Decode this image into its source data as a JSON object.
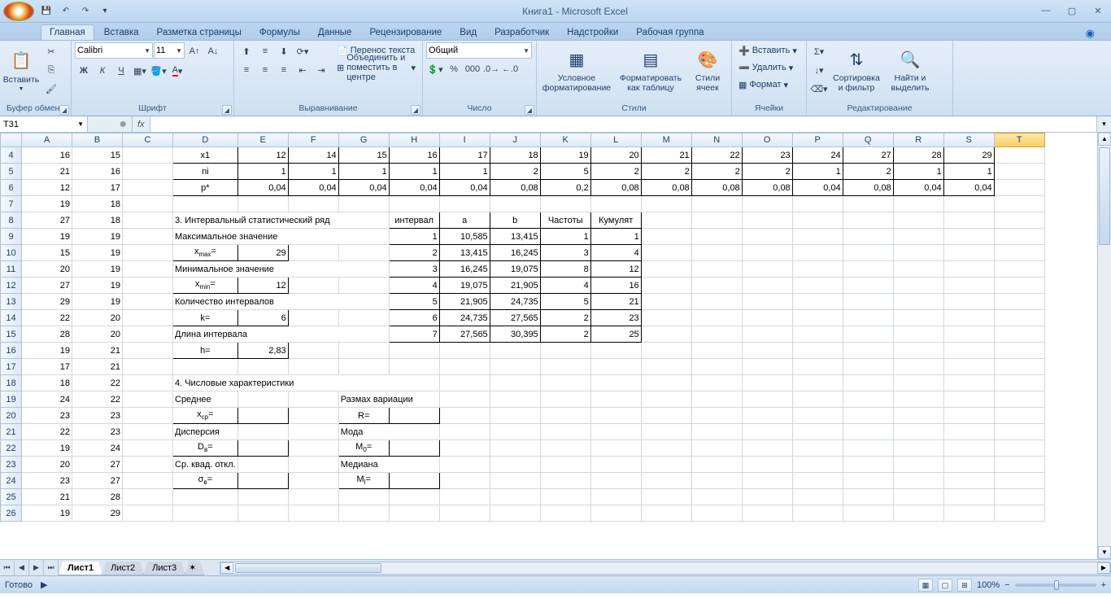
{
  "title": "Книга1 - Microsoft Excel",
  "tabs": [
    "Главная",
    "Вставка",
    "Разметка страницы",
    "Формулы",
    "Данные",
    "Рецензирование",
    "Вид",
    "Разработчик",
    "Надстройки",
    "Рабочая группа"
  ],
  "activeTab": 0,
  "ribbon": {
    "clipboard": {
      "paste": "Вставить",
      "title": "Буфер обмена"
    },
    "font": {
      "name": "Calibri",
      "size": "11",
      "title": "Шрифт",
      "bold": "Ж",
      "italic": "К",
      "underline": "Ч"
    },
    "align": {
      "title": "Выравнивание",
      "wrap": "Перенос текста",
      "merge": "Объединить и поместить в центре"
    },
    "number": {
      "title": "Число",
      "format": "Общий"
    },
    "styles": {
      "title": "Стили",
      "cond": "Условное форматирование",
      "ftable": "Форматировать как таблицу",
      "cstyles": "Стили ячеек"
    },
    "cells": {
      "title": "Ячейки",
      "insert": "Вставить",
      "delete": "Удалить",
      "format": "Формат"
    },
    "editing": {
      "title": "Редактирование",
      "sort": "Сортировка и фильтр",
      "find": "Найти и выделить"
    }
  },
  "nameBox": "T31",
  "formula": "",
  "columns": [
    "A",
    "B",
    "C",
    "D",
    "E",
    "F",
    "G",
    "H",
    "I",
    "J",
    "K",
    "L",
    "M",
    "N",
    "O",
    "P",
    "Q",
    "R",
    "S",
    "T"
  ],
  "rows": [
    4,
    5,
    6,
    7,
    8,
    9,
    10,
    11,
    12,
    13,
    14,
    15,
    16,
    17,
    18,
    19,
    20,
    21,
    22,
    23,
    24,
    25,
    26
  ],
  "activeCell": {
    "row": 31,
    "col": "T",
    "ref": "T31"
  },
  "cells": {
    "4": {
      "A": "16",
      "B": "15",
      "D": "x1",
      "E": "12",
      "F": "14",
      "G": "15",
      "H": "16",
      "I": "17",
      "J": "18",
      "K": "19",
      "L": "20",
      "M": "21",
      "N": "22",
      "O": "23",
      "P": "24",
      "Q": "27",
      "R": "28",
      "S": "29"
    },
    "5": {
      "A": "21",
      "B": "16",
      "D": "ni",
      "E": "1",
      "F": "1",
      "G": "1",
      "H": "1",
      "I": "1",
      "J": "2",
      "K": "5",
      "L": "2",
      "M": "2",
      "N": "2",
      "O": "2",
      "P": "1",
      "Q": "2",
      "R": "1",
      "S": "1"
    },
    "6": {
      "A": "12",
      "B": "17",
      "D": "p*",
      "E": "0,04",
      "F": "0,04",
      "G": "0,04",
      "H": "0,04",
      "I": "0,04",
      "J": "0,08",
      "K": "0,2",
      "L": "0,08",
      "M": "0,08",
      "N": "0,08",
      "O": "0,08",
      "P": "0,04",
      "Q": "0,08",
      "R": "0,04",
      "S": "0,04"
    },
    "7": {
      "A": "19",
      "B": "18"
    },
    "8": {
      "A": "27",
      "B": "18",
      "D": "3. Интервальный статистический ряд",
      "H": "интервал",
      "I": "a",
      "J": "b",
      "K": "Частоты",
      "L": "Кумулят"
    },
    "9": {
      "A": "19",
      "B": "19",
      "D": "Максимальное значение",
      "H": "1",
      "I": "10,585",
      "J": "13,415",
      "K": "1",
      "L": "1"
    },
    "10": {
      "A": "15",
      "B": "19",
      "D": "xmax=",
      "E": "29",
      "H": "2",
      "I": "13,415",
      "J": "16,245",
      "K": "3",
      "L": "4"
    },
    "11": {
      "A": "20",
      "B": "19",
      "D": "Минимальное значение",
      "H": "3",
      "I": "16,245",
      "J": "19,075",
      "K": "8",
      "L": "12"
    },
    "12": {
      "A": "27",
      "B": "19",
      "D": "xmin=",
      "E": "12",
      "H": "4",
      "I": "19,075",
      "J": "21,905",
      "K": "4",
      "L": "16"
    },
    "13": {
      "A": "29",
      "B": "19",
      "D": "Количество интервалов",
      "H": "5",
      "I": "21,905",
      "J": "24,735",
      "K": "5",
      "L": "21"
    },
    "14": {
      "A": "22",
      "B": "20",
      "D": "k=",
      "E": "6",
      "H": "6",
      "I": "24,735",
      "J": "27,565",
      "K": "2",
      "L": "23"
    },
    "15": {
      "A": "28",
      "B": "20",
      "D": "Длина интервала",
      "H": "7",
      "I": "27,565",
      "J": "30,395",
      "K": "2",
      "L": "25"
    },
    "16": {
      "A": "19",
      "B": "21",
      "D": "h=",
      "E": "2,83"
    },
    "17": {
      "A": "17",
      "B": "21"
    },
    "18": {
      "A": "18",
      "B": "22",
      "D": "4. Числовые характеристики"
    },
    "19": {
      "A": "24",
      "B": "22",
      "D": "Среднее",
      "G": "Размах вариации"
    },
    "20": {
      "A": "23",
      "B": "23",
      "D": "xcp=",
      "G": "R="
    },
    "21": {
      "A": "22",
      "B": "23",
      "D": "Дисперсия",
      "G": "Мода"
    },
    "22": {
      "A": "19",
      "B": "24",
      "D": "Dв=",
      "G": "M0="
    },
    "23": {
      "A": "20",
      "B": "27",
      "D": "Ср. квад. откл.",
      "G": "Медиана"
    },
    "24": {
      "A": "23",
      "B": "27",
      "D": "σв=",
      "G": "Ml="
    },
    "25": {
      "A": "21",
      "B": "28"
    },
    "26": {
      "A": "19",
      "B": "29"
    }
  },
  "bordered": {
    "4": [
      "D",
      "E",
      "F",
      "G",
      "H",
      "I",
      "J",
      "K",
      "L",
      "M",
      "N",
      "O",
      "P",
      "Q",
      "R",
      "S"
    ],
    "5": [
      "D",
      "E",
      "F",
      "G",
      "H",
      "I",
      "J",
      "K",
      "L",
      "M",
      "N",
      "O",
      "P",
      "Q",
      "R",
      "S"
    ],
    "6": [
      "D",
      "E",
      "F",
      "G",
      "H",
      "I",
      "J",
      "K",
      "L",
      "M",
      "N",
      "O",
      "P",
      "Q",
      "R",
      "S"
    ],
    "8": [
      "H",
      "I",
      "J",
      "K",
      "L"
    ],
    "9": [
      "H",
      "I",
      "J",
      "K",
      "L"
    ],
    "10": [
      "D",
      "E",
      "H",
      "I",
      "J",
      "K",
      "L"
    ],
    "11": [
      "H",
      "I",
      "J",
      "K",
      "L"
    ],
    "12": [
      "D",
      "E",
      "H",
      "I",
      "J",
      "K",
      "L"
    ],
    "13": [
      "H",
      "I",
      "J",
      "K",
      "L"
    ],
    "14": [
      "D",
      "E",
      "H",
      "I",
      "J",
      "K",
      "L"
    ],
    "15": [
      "H",
      "I",
      "J",
      "K",
      "L"
    ],
    "16": [
      "D",
      "E"
    ],
    "20": [
      "D",
      "E",
      "G",
      "H"
    ],
    "22": [
      "D",
      "E",
      "G",
      "H"
    ],
    "24": [
      "D",
      "E",
      "G",
      "H"
    ]
  },
  "centered": {
    "4": [
      "D"
    ],
    "5": [
      "D"
    ],
    "6": [
      "D"
    ],
    "8": [
      "H",
      "I",
      "J",
      "K",
      "L"
    ],
    "10": [
      "D"
    ],
    "12": [
      "D"
    ],
    "14": [
      "D"
    ],
    "16": [
      "D"
    ],
    "20": [
      "D",
      "G"
    ],
    "22": [
      "D",
      "G"
    ],
    "24": [
      "D",
      "G"
    ]
  },
  "textLeft": {
    "8": [
      "D"
    ],
    "9": [
      "D"
    ],
    "11": [
      "D"
    ],
    "13": [
      "D"
    ],
    "15": [
      "D"
    ],
    "18": [
      "D"
    ],
    "19": [
      "D",
      "G"
    ],
    "21": [
      "D",
      "G"
    ],
    "23": [
      "D",
      "G"
    ]
  },
  "spans": {
    "8": {
      "D": 4
    },
    "9": {
      "D": 4
    },
    "11": {
      "D": 4
    },
    "13": {
      "D": 4
    },
    "15": {
      "D": 4
    },
    "18": {
      "D": 5
    },
    "19": {
      "G": 2
    },
    "21": {
      "G": 2
    },
    "23": {
      "G": 2
    }
  },
  "sheets": [
    "Лист1",
    "Лист2",
    "Лист3"
  ],
  "activeSheet": 0,
  "status": "Готово",
  "zoom": "100%"
}
